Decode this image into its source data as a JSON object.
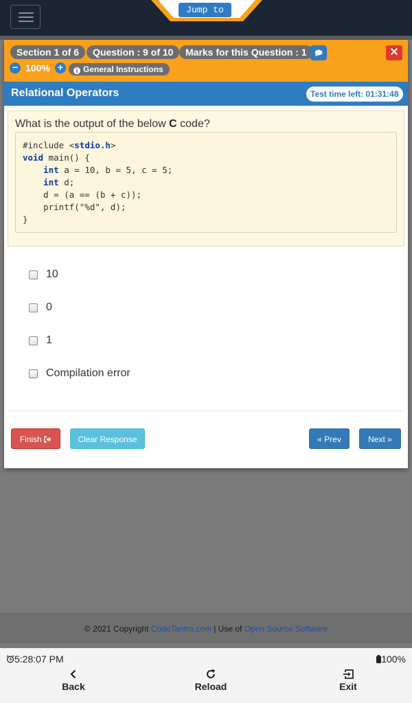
{
  "navbar": {
    "jump_label": "Jump to"
  },
  "header": {
    "section": "Section 1 of 6",
    "question": "Question : 9 of 10",
    "marks": "Marks for this Question : 1",
    "zoom": "100%",
    "general_instructions": "General Instructions"
  },
  "topic": {
    "title": "Relational Operators",
    "timer": "Test time left: 01:31:48"
  },
  "question": {
    "prefix": "What is the output of the below ",
    "lang": "C",
    "suffix": " code?",
    "code_lines": [
      "#include <stdio.h>",
      "void main() {",
      "    int a = 10, b = 5, c = 5;",
      "    int d;",
      "    d = (a == (b + c));",
      "    printf(\"%d\", d);",
      "}"
    ]
  },
  "options": [
    "10",
    "0",
    "1",
    "Compilation error"
  ],
  "actions": {
    "finish": "Finish",
    "clear": "Clear Response",
    "prev": "Prev",
    "next": "Next"
  },
  "footer": {
    "copyright": "© 2021 Copyright",
    "site": "CodeTantra.com",
    "separator": "| Use of",
    "oss": "Open Source Software"
  },
  "statusbar": {
    "time": "5:28:07 PM",
    "battery": "100%"
  },
  "bottom_nav": {
    "back": "Back",
    "reload": "Reload",
    "exit": "Exit"
  },
  "colors": {
    "header_orange": "#f9a11b",
    "topic_blue": "#2e7cc1",
    "finish_red": "#d9534f",
    "clear_cyan": "#5bc0de",
    "nav_blue": "#337ab7"
  }
}
